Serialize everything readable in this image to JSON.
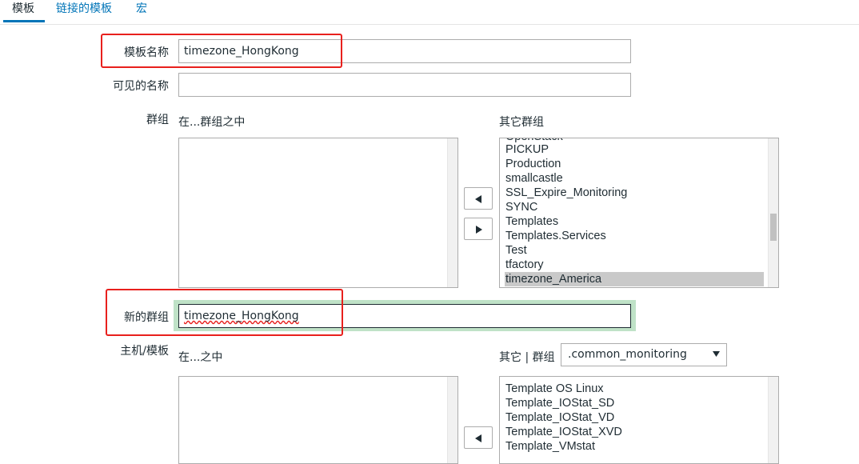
{
  "tabs": [
    {
      "label": "模板",
      "active": true
    },
    {
      "label": "链接的模板",
      "active": false
    },
    {
      "label": "宏",
      "active": false
    }
  ],
  "form": {
    "template_name_label": "模板名称",
    "template_name_value": "timezone_HongKong",
    "visible_name_label": "可见的名称",
    "visible_name_value": "",
    "groups_label": "群组",
    "in_groups_label": "在...群组之中",
    "other_groups_label": "其它群组",
    "other_groups_list": [
      "OpenStack",
      "PICKUP",
      "Production",
      "smallcastle",
      "SSL_Expire_Monitoring",
      "SYNC",
      "Templates",
      "Templates.Services",
      "Test",
      "tfactory",
      "timezone_America"
    ],
    "other_groups_selected": "timezone_America",
    "new_group_label": "新的群组",
    "new_group_value": "timezone_HongKong",
    "hosts_label": "主机/模板",
    "in_hosts_label": "在...之中",
    "other_group_label": "其它 | 群组",
    "other_group_select": ".common_monitoring",
    "other_hosts_list": [
      "Template OS Linux",
      "Template_IOStat_SD",
      "Template_IOStat_VD",
      "Template_IOStat_XVD",
      "Template_VMstat"
    ]
  },
  "icons": {
    "move_left": "triangle-left-icon",
    "move_right": "triangle-right-icon",
    "dropdown": "triangle-down-icon"
  },
  "colors": {
    "link": "#0275b8",
    "highlight_box": "#e8201d",
    "focus_glow": "#bfe2c7",
    "selected_option": "#c9c9c9"
  }
}
